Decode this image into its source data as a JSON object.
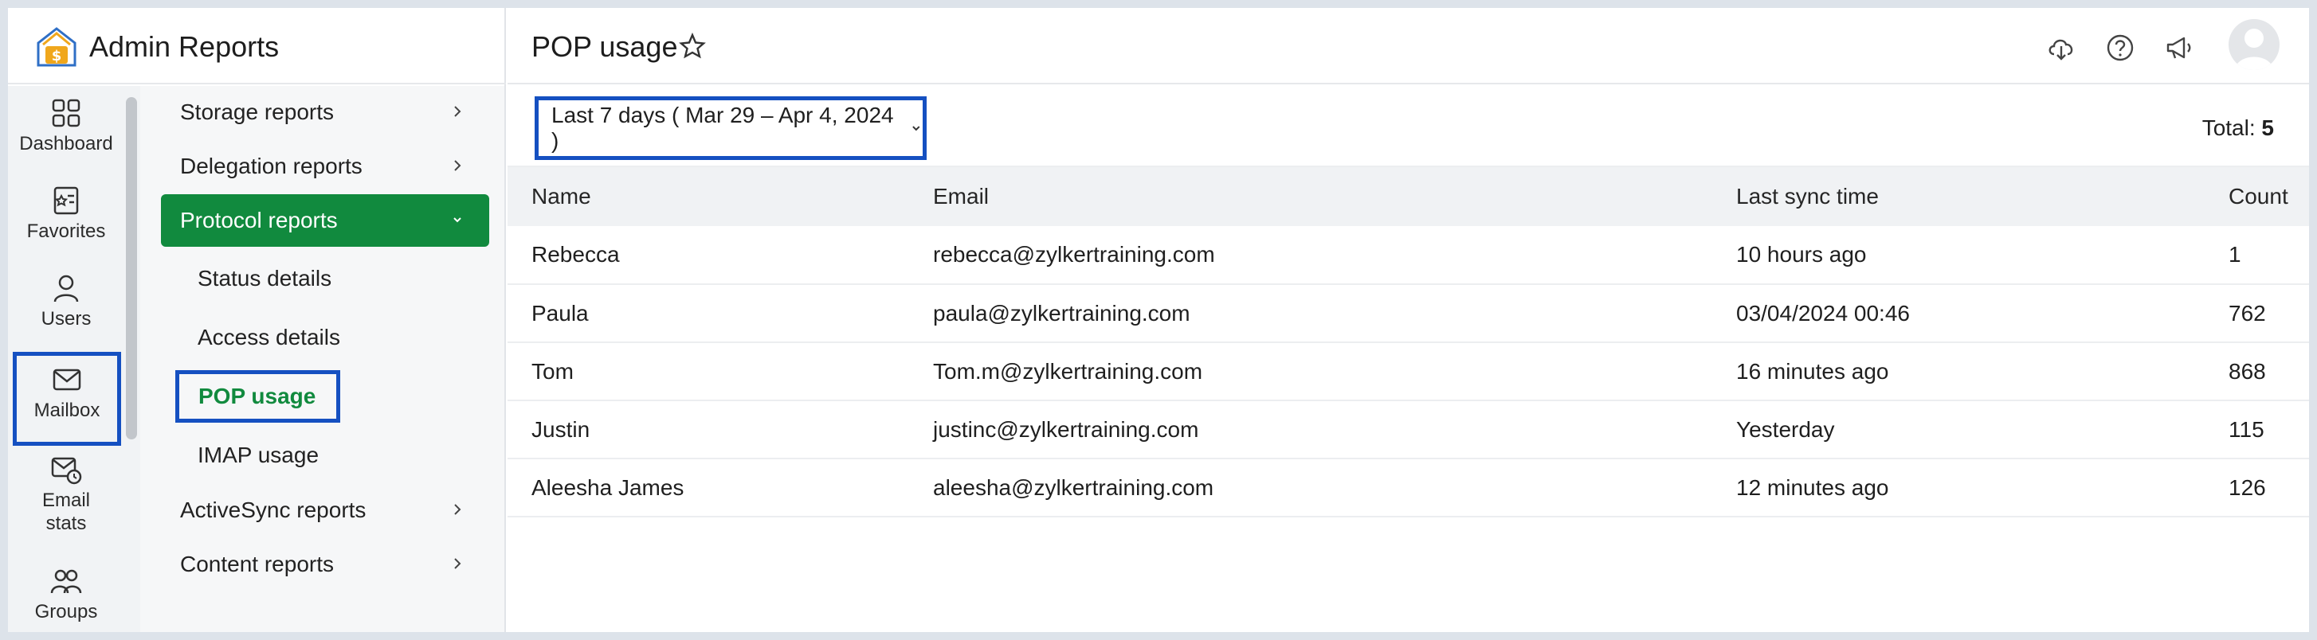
{
  "app": {
    "title": "Admin Reports"
  },
  "rail": {
    "items": [
      {
        "label": "Dashboard",
        "icon": "dashboard-icon"
      },
      {
        "label": "Favorites",
        "icon": "favorites-icon"
      },
      {
        "label": "Users",
        "icon": "user-icon"
      },
      {
        "label": "Mailbox",
        "icon": "mailbox-icon",
        "active": true
      },
      {
        "label_line1": "Email",
        "label_line2": "stats",
        "icon": "email-stats-icon"
      },
      {
        "label": "Groups",
        "icon": "groups-icon"
      }
    ]
  },
  "subnav": {
    "items": [
      {
        "label": "Storage reports"
      },
      {
        "label": "Delegation reports"
      },
      {
        "label": "Protocol reports",
        "open": true
      },
      {
        "label": "ActiveSync reports"
      },
      {
        "label": "Content reports"
      }
    ],
    "sub_items": [
      {
        "label": "Status details"
      },
      {
        "label": "Access details"
      },
      {
        "label": "POP usage",
        "selected": true
      },
      {
        "label": "IMAP usage"
      }
    ]
  },
  "header": {
    "title": "POP usage"
  },
  "toolbar": {
    "date_range": "Last 7 days ( Mar 29 – Apr 4, 2024 )",
    "total_label": "Total:",
    "total_value": "5"
  },
  "table": {
    "columns": [
      "Name",
      "Email",
      "Last sync time",
      "Count"
    ],
    "rows": [
      [
        "Rebecca",
        "rebecca@zylkertraining.com",
        "10 hours ago",
        "1"
      ],
      [
        "Paula",
        "paula@zylkertraining.com",
        "03/04/2024 00:46",
        "762"
      ],
      [
        "Tom",
        "Tom.m@zylkertraining.com",
        "16 minutes ago",
        "868"
      ],
      [
        "Justin",
        "justinc@zylkertraining.com",
        "Yesterday",
        "115"
      ],
      [
        "Aleesha James",
        "aleesha@zylkertraining.com",
        "12 minutes ago",
        "126"
      ]
    ]
  },
  "colors": {
    "accent_green": "#118a3e",
    "highlight_blue": "#1550c1",
    "logo_orange": "#f0a71c",
    "logo_blue": "#2f6fc6"
  }
}
